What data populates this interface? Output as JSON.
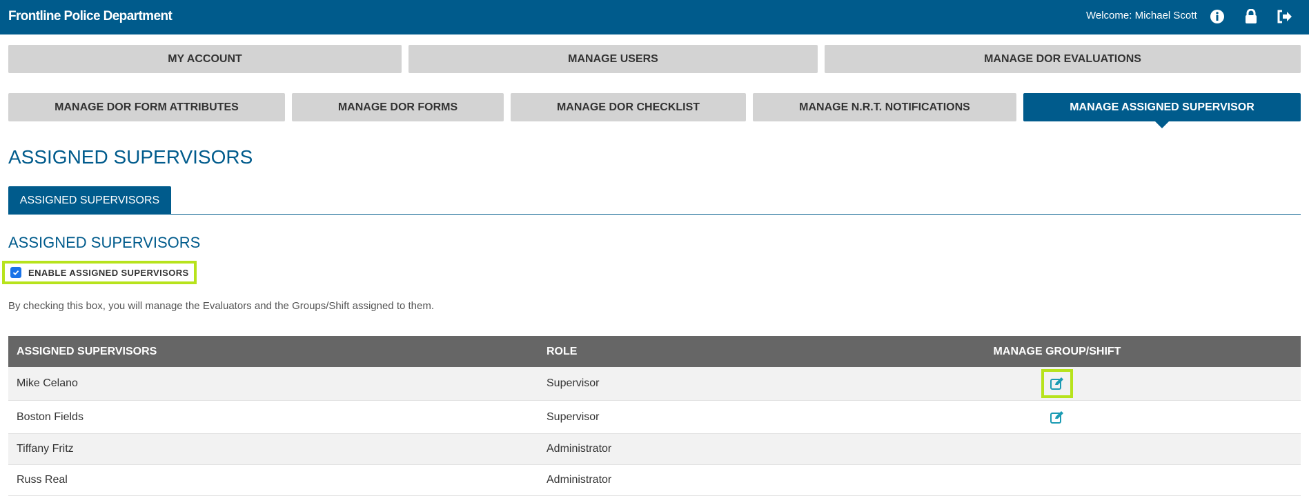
{
  "header": {
    "brand": "Frontline Police Department",
    "welcome": "Welcome: Michael Scott",
    "icons": [
      "info-icon",
      "lock-icon",
      "logout-icon"
    ]
  },
  "nav": {
    "row1": [
      "MY ACCOUNT",
      "MANAGE USERS",
      "MANAGE DOR EVALUATIONS"
    ],
    "row2": [
      "MANAGE DOR FORM ATTRIBUTES",
      "MANAGE DOR FORMS",
      "MANAGE DOR CHECKLIST",
      "MANAGE N.R.T. NOTIFICATIONS",
      "MANAGE ASSIGNED SUPERVISOR"
    ],
    "active": "MANAGE ASSIGNED SUPERVISOR"
  },
  "page": {
    "title": "ASSIGNED SUPERVISORS",
    "tab": "ASSIGNED SUPERVISORS",
    "section_title": "ASSIGNED SUPERVISORS",
    "enable_label": "ENABLE ASSIGNED SUPERVISORS",
    "enable_checked": true,
    "description": "By checking this box, you will manage the Evaluators and the Groups/Shift assigned to them."
  },
  "table": {
    "headers": [
      "ASSIGNED SUPERVISORS",
      "ROLE",
      "MANAGE GROUP/SHIFT"
    ],
    "rows": [
      {
        "name": "Mike Celano",
        "role": "Supervisor",
        "editable": true
      },
      {
        "name": "Boston Fields",
        "role": "Supervisor",
        "editable": true
      },
      {
        "name": "Tiffany Fritz",
        "role": "Administrator",
        "editable": false
      },
      {
        "name": "Russ Real",
        "role": "Administrator",
        "editable": false
      }
    ]
  },
  "colors": {
    "primary": "#005b8c",
    "highlight": "#b7e31c",
    "nav_inactive": "#d3d3d3",
    "table_header": "#666666",
    "edit_icon": "#1a9bb3"
  }
}
